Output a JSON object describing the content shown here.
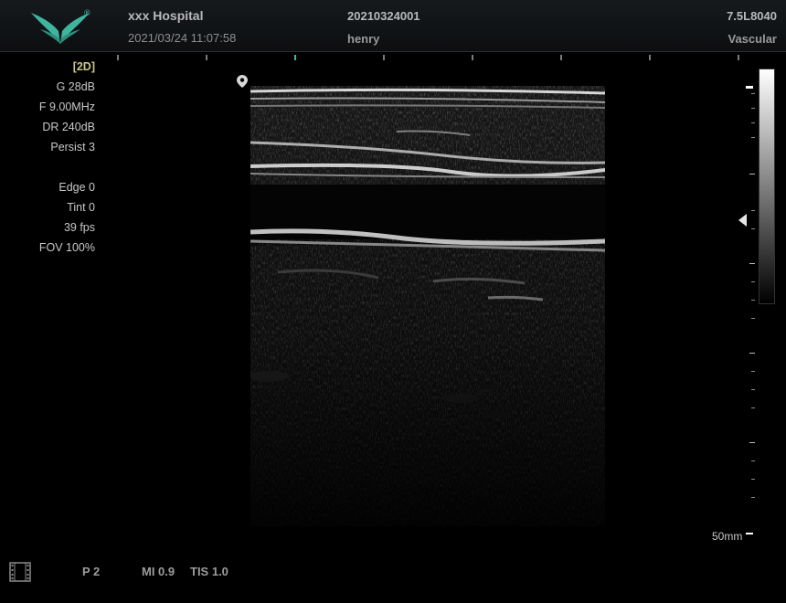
{
  "header": {
    "hospital": "xxx Hospital",
    "datetime": "2021/03/24 11:07:58",
    "patient_id": "20210324001",
    "operator": "henry",
    "probe": "7.5L8040",
    "preset": "Vascular",
    "logo_icon": "butterfly-logo-icon",
    "accent_color": "#3fb5a0"
  },
  "params": {
    "mode": "[2D]",
    "gain": "G 28dB",
    "frequency": "F 9.00MHz",
    "dynamic_range": "DR 240dB",
    "persist": "Persist 3",
    "edge": "Edge 0",
    "tint": "Tint 0",
    "fps": "39 fps",
    "fov": "FOV 100%"
  },
  "scale": {
    "depth_label": "50mm"
  },
  "status": {
    "page": "P 2",
    "mi": "MI 0.9",
    "tis": "TIS 1.0",
    "cine_icon": "film-strip-icon"
  }
}
